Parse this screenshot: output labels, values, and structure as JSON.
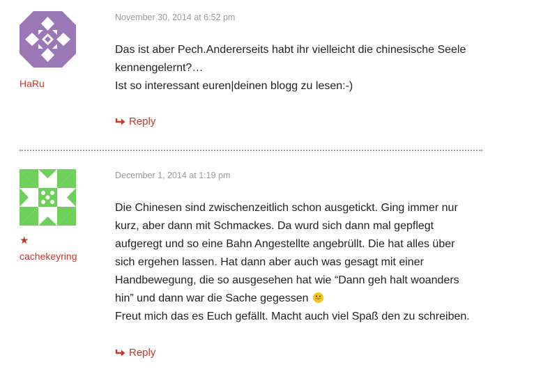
{
  "comments": [
    {
      "author": "HaRu",
      "date": "November 30, 2014 at 6:52 pm",
      "text": "Das ist aber Pech.Andererseits habt ihr vielleicht die chinesische Seele\nkennengelernt?…\nIst so interessant euren|deinen blogg zu lesen:-)",
      "reply_label": "Reply",
      "avatar_color": "#9a77b5"
    },
    {
      "author": "cachekeyring",
      "author_badge": "★",
      "date": "December 1, 2014 at 1:19 pm",
      "text_before_emoji": "Die Chinesen sind zwischenzeitlich schon ausgetickt. Ging immer nur\nkurz, aber dann mit Schmackes. Da wurd sich dann mal gepflegt\naufgeregt und so eine Bahn Angestellte angebrüllt. Die hat alles über\nsich ergehen lassen. Hat dann aber auch was gesagt mit einer\nHandbewegung, die so ausgesehen hat wie “Dann geh halt woanders\nhin” und dann war die Sache gegessen ",
      "text_after_emoji": "\nFreut mich das es Euch gefällt. Macht auch viel Spaß den zu schreiben.",
      "reply_label": "Reply",
      "avatar_color": "#6fcf5b"
    }
  ],
  "colors": {
    "accent": "#c0392b",
    "meta": "#9a9a9a",
    "text": "#222222"
  }
}
